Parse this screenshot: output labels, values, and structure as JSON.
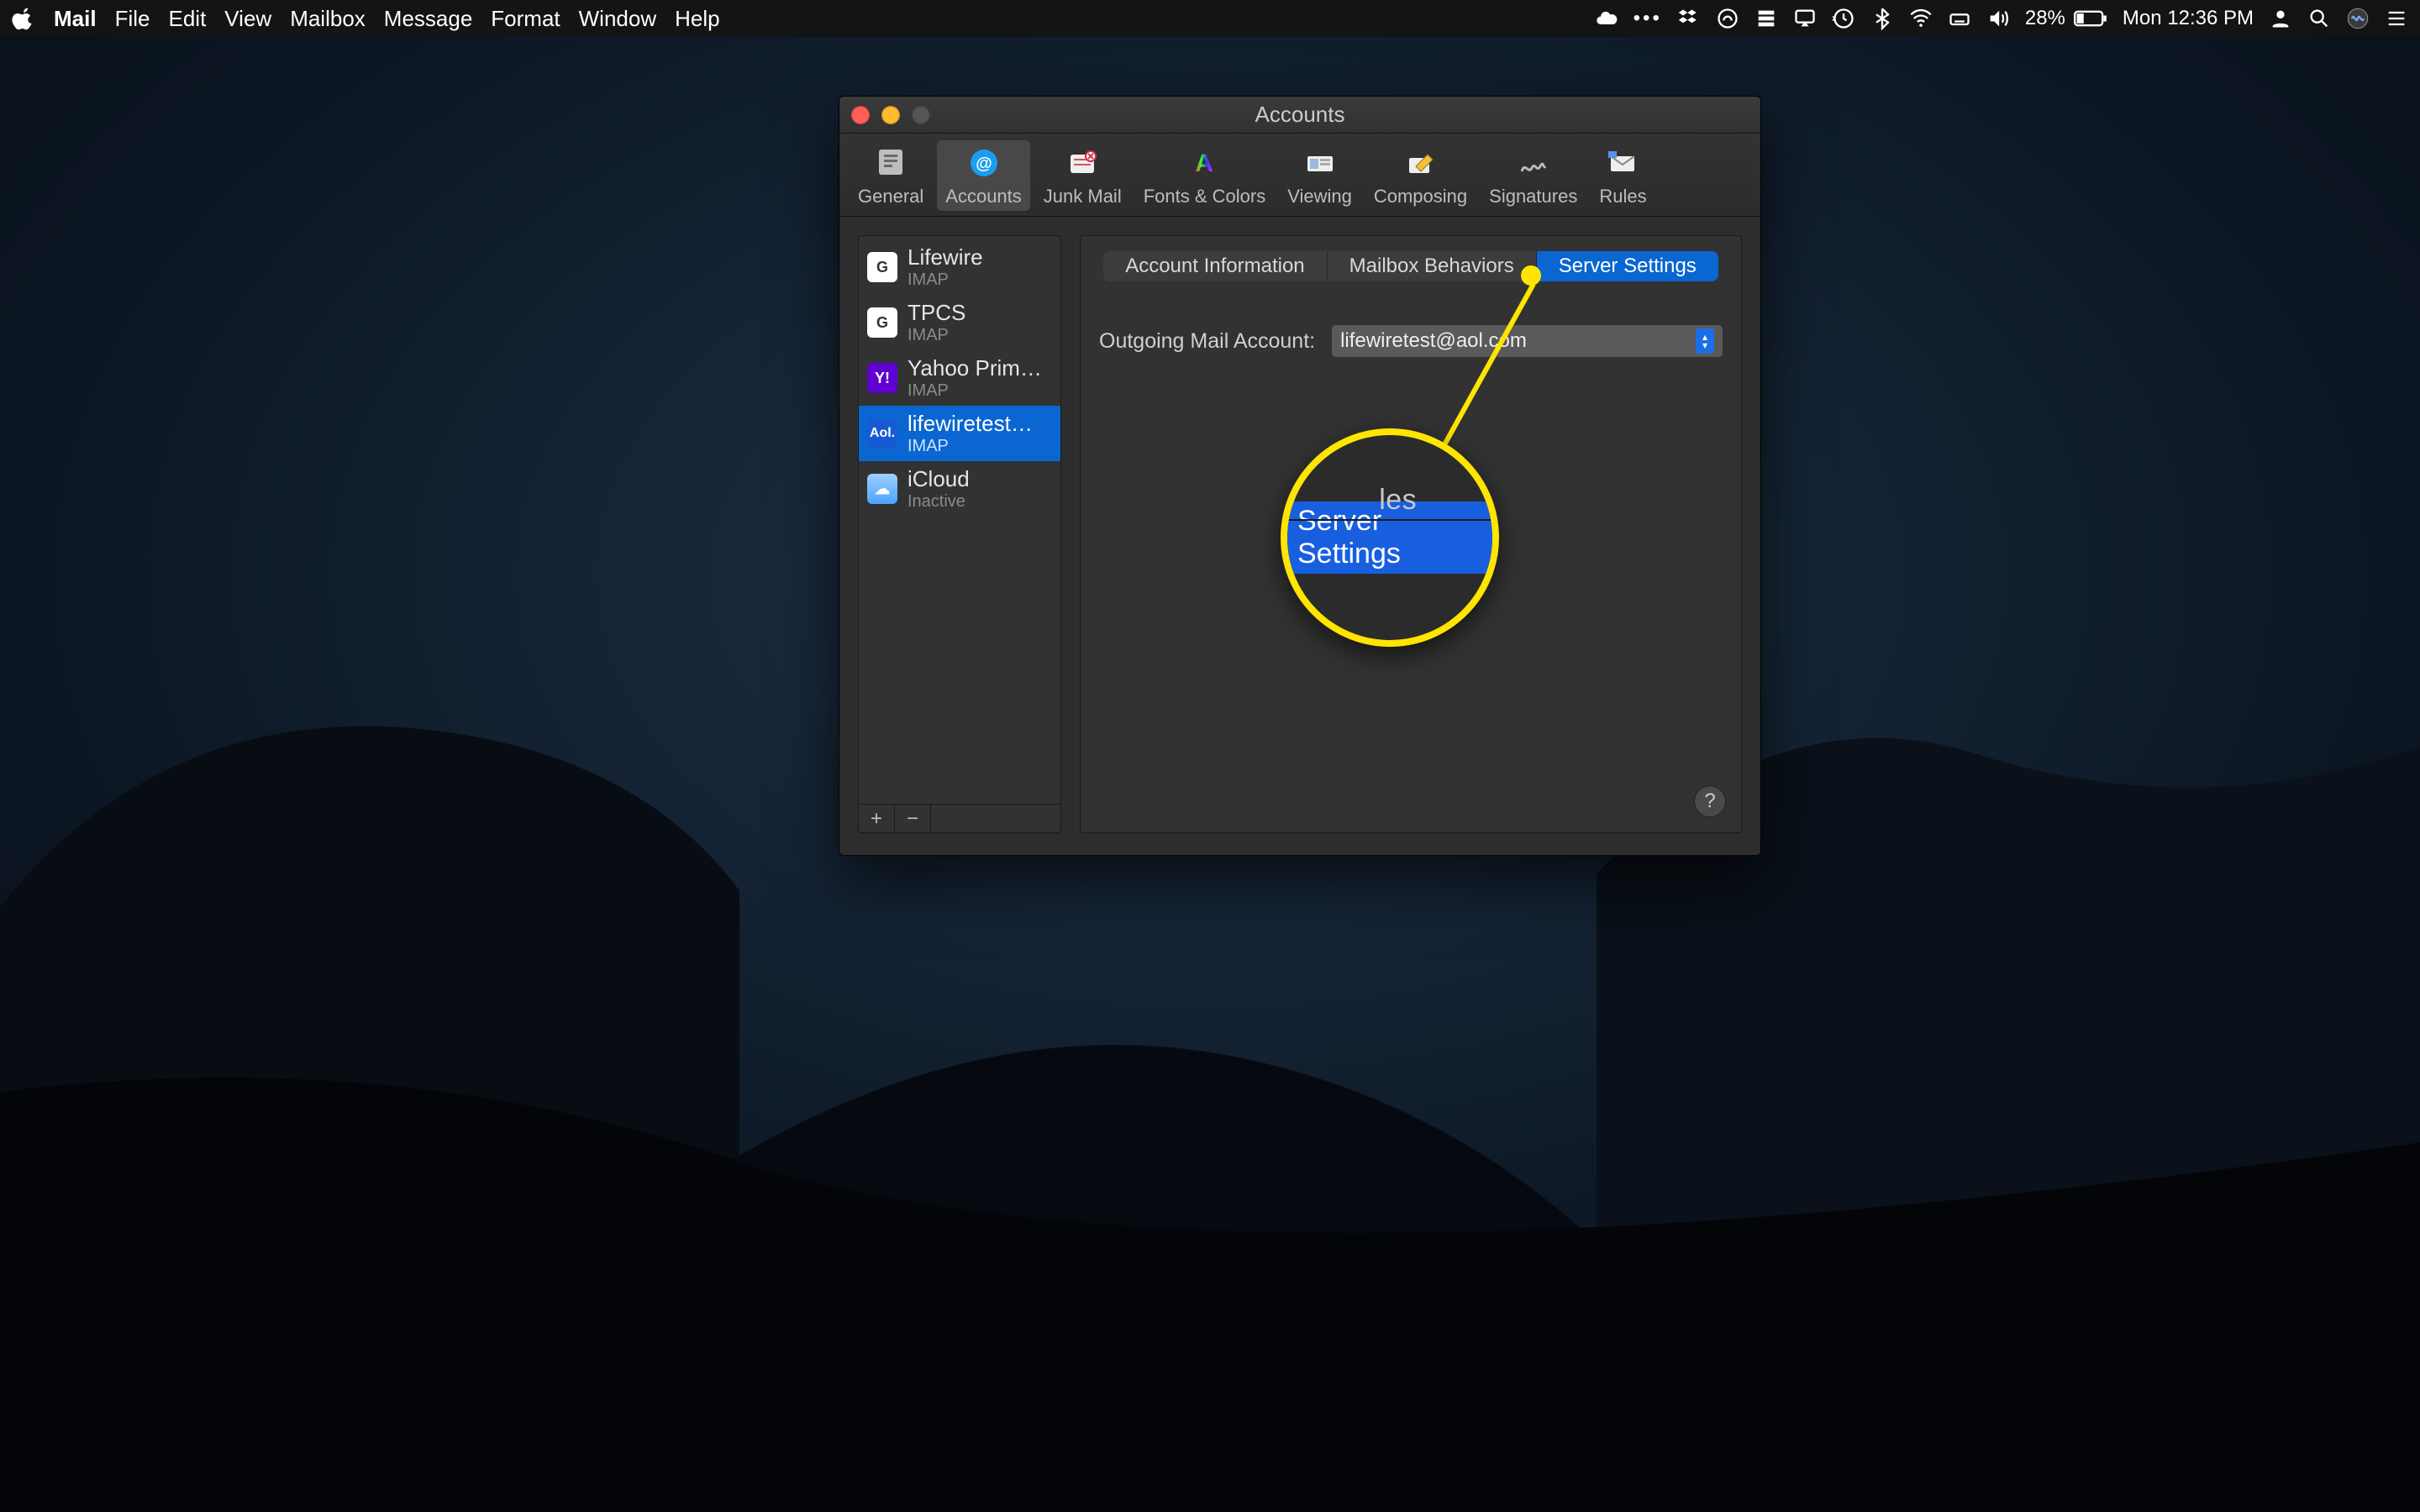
{
  "menubar": {
    "app_name": "Mail",
    "items": [
      "File",
      "Edit",
      "View",
      "Mailbox",
      "Message",
      "Format",
      "Window",
      "Help"
    ],
    "battery_pct": "28%",
    "clock": "Mon 12:36 PM"
  },
  "window": {
    "title": "Accounts"
  },
  "toolbar": {
    "items": [
      {
        "label": "General"
      },
      {
        "label": "Accounts"
      },
      {
        "label": "Junk Mail"
      },
      {
        "label": "Fonts & Colors"
      },
      {
        "label": "Viewing"
      },
      {
        "label": "Composing"
      },
      {
        "label": "Signatures"
      },
      {
        "label": "Rules"
      }
    ],
    "active_index": 1
  },
  "accounts": [
    {
      "name": "Lifewire",
      "sub": "IMAP",
      "provider": "google",
      "short": "G"
    },
    {
      "name": "TPCS",
      "sub": "IMAP",
      "provider": "google",
      "short": "G"
    },
    {
      "name": "Yahoo Prim…",
      "sub": "IMAP",
      "provider": "yahoo",
      "short": "Y!"
    },
    {
      "name": "lifewiretest…",
      "sub": "IMAP",
      "provider": "aol",
      "short": "Aol."
    },
    {
      "name": "iCloud",
      "sub": "Inactive",
      "provider": "icloud",
      "short": "☁"
    }
  ],
  "accounts_selected_index": 3,
  "tabs": {
    "items": [
      "Account Information",
      "Mailbox Behaviors",
      "Server Settings"
    ],
    "active_index": 2
  },
  "outgoing": {
    "label": "Outgoing Mail Account:",
    "value": "lifewiretest@aol.com"
  },
  "sidebar_buttons": {
    "add": "+",
    "remove": "−"
  },
  "help_label": "?",
  "annotation": {
    "lens_tab_label": "Server Settings",
    "lens_partial_text": "ules"
  }
}
